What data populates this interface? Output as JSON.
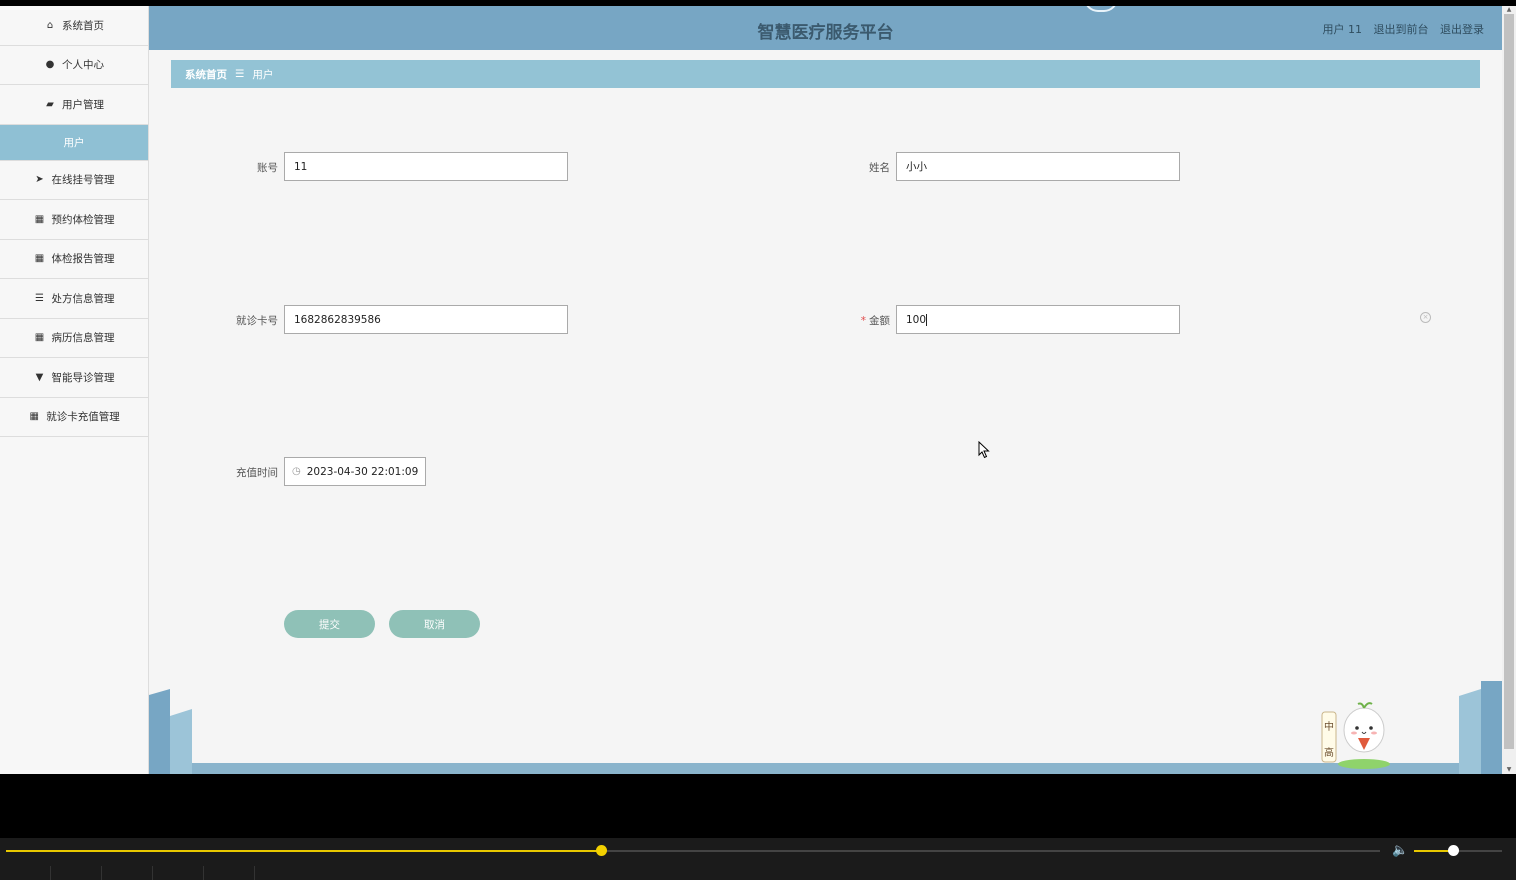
{
  "header": {
    "title": "智慧医疗服务平台",
    "user": "用户 11",
    "to_front": "退出到前台",
    "logout": "退出登录"
  },
  "sidebar": {
    "items": [
      {
        "label": "系统首页",
        "icon": "home-icon",
        "glyph": "⌂"
      },
      {
        "label": "个人中心",
        "icon": "user-icon",
        "glyph": "●"
      },
      {
        "label": "用户管理",
        "icon": "briefcase-icon",
        "glyph": "▰"
      },
      {
        "label": "用户",
        "icon": "",
        "glyph": ""
      },
      {
        "label": "在线挂号管理",
        "icon": "send-icon",
        "glyph": "➤"
      },
      {
        "label": "预约体检管理",
        "icon": "grid-icon",
        "glyph": "▦"
      },
      {
        "label": "体检报告管理",
        "icon": "grid-icon",
        "glyph": "▦"
      },
      {
        "label": "处方信息管理",
        "icon": "list-icon",
        "glyph": "☰"
      },
      {
        "label": "病历信息管理",
        "icon": "grid-icon",
        "glyph": "▦"
      },
      {
        "label": "智能导诊管理",
        "icon": "marker-icon",
        "glyph": "▼"
      },
      {
        "label": "就诊卡充值管理",
        "icon": "grid-small-icon",
        "glyph": "▦"
      }
    ]
  },
  "breadcrumb": {
    "home": "系统首页",
    "separator": "☰",
    "current": "用户"
  },
  "form": {
    "account_label": "账号",
    "account_value": "11",
    "name_label": "姓名",
    "name_value": "小小",
    "card_label": "就诊卡号",
    "card_value": "1682862839586",
    "amount_required": "*",
    "amount_label": "金额",
    "amount_value": "100",
    "time_label": "充值时间",
    "time_value": "2023-04-30 22:01:09"
  },
  "buttons": {
    "submit": "提交",
    "cancel": "取消"
  },
  "mascot": {
    "text": "中 高"
  },
  "player": {
    "progress": 0.433,
    "volume": 0.44
  },
  "colors": {
    "header": "#77a6c4",
    "breadcrumb": "#93c3d5",
    "active_menu": "#8fc0d4",
    "button": "#8fc1b7",
    "progress": "#e8c800"
  }
}
